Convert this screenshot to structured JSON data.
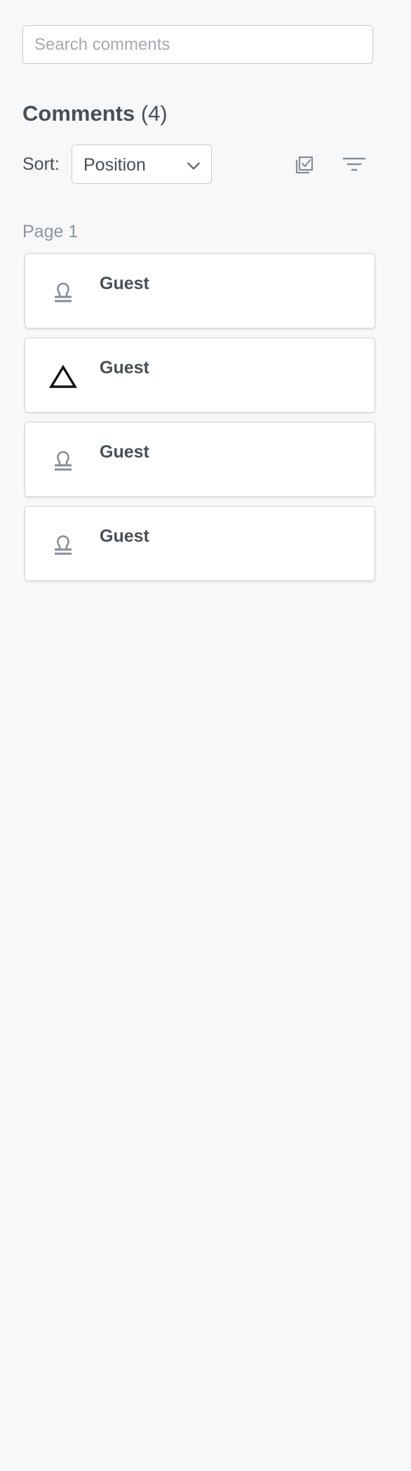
{
  "search": {
    "placeholder": "Search comments"
  },
  "header": {
    "title": "Comments",
    "count": "(4)"
  },
  "sort": {
    "label": "Sort:",
    "selected": "Position"
  },
  "tools": {
    "multi_select_icon": "multi-select-icon",
    "filter_icon": "filter-icon"
  },
  "pages": [
    {
      "label": "Page 1",
      "comments": [
        {
          "author": "Guest",
          "icon": "stamp-icon"
        },
        {
          "author": "Guest",
          "icon": "triangle-icon"
        },
        {
          "author": "Guest",
          "icon": "stamp-icon"
        },
        {
          "author": "Guest",
          "icon": "stamp-icon"
        }
      ]
    }
  ],
  "colors": {
    "background": "#f7f8fa",
    "text": "#485056",
    "muted": "#8f969d",
    "border": "#c7cbd0"
  }
}
